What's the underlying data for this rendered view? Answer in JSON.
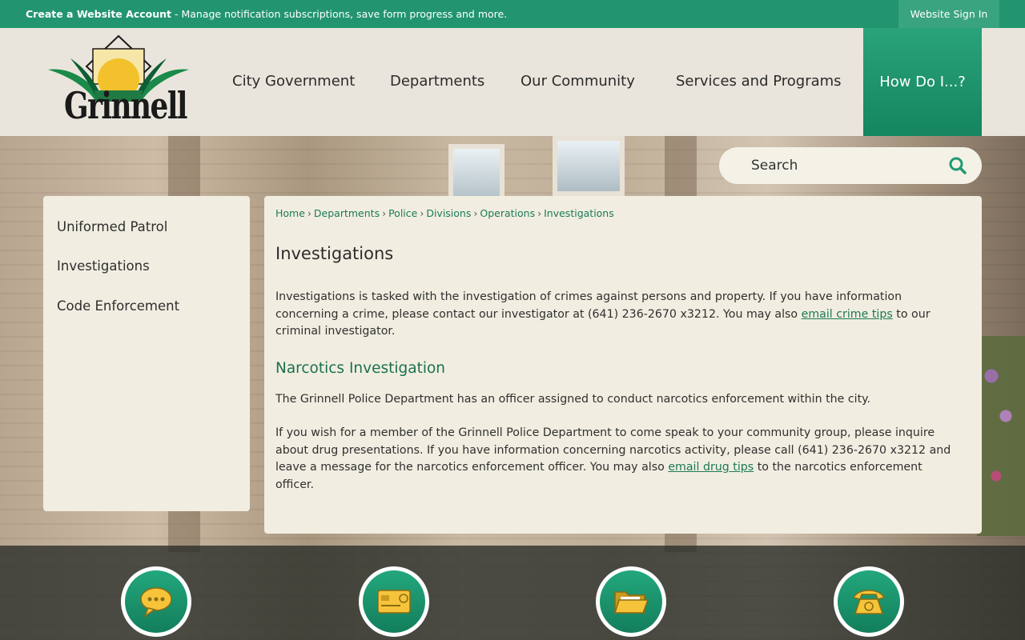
{
  "topbar": {
    "account_link": "Create a Website Account",
    "account_desc": " - Manage notification subscriptions, save form progress and more.",
    "signin": "Website Sign In"
  },
  "logo": {
    "word": "Grinnell"
  },
  "nav": {
    "items": [
      "City Government",
      "Departments",
      "Our Community",
      "Services and Programs"
    ],
    "howdo": "How Do I...?"
  },
  "search": {
    "placeholder": "Search"
  },
  "sidenav": {
    "items": [
      "Uniformed Patrol",
      "Investigations",
      "Code Enforcement"
    ]
  },
  "breadcrumb": [
    "Home",
    "Departments",
    "Police",
    "Divisions",
    "Operations",
    "Investigations"
  ],
  "content": {
    "title": "Investigations",
    "p1_a": "Investigations is tasked with the investigation of crimes against persons and property. If you have information concerning a crime, please contact our investigator at (641) 236-2670 x3212. You may also ",
    "p1_link": "email crime tips",
    "p1_b": " to our criminal investigator.",
    "subhead": "Narcotics Investigation",
    "p2": "The Grinnell Police Department has an officer assigned to conduct narcotics enforcement within the city.",
    "p3_a": "If you wish for a member of the Grinnell Police Department to come speak to your community group, please inquire about drug presentations. If you have information concerning narcotics activity, please call (641) 236-2670 x3212 and leave a message for the narcotics enforcement officer. You may also ",
    "p3_link": "email drug tips",
    "p3_b": " to the narcotics enforcement officer."
  },
  "quicklinks": {
    "icons": [
      "speech-bubble-icon",
      "payment-card-icon",
      "folder-icon",
      "telephone-icon"
    ],
    "accent": "#1e9a72"
  },
  "colors": {
    "brand_green": "#229470",
    "link_green": "#1b7a55"
  }
}
